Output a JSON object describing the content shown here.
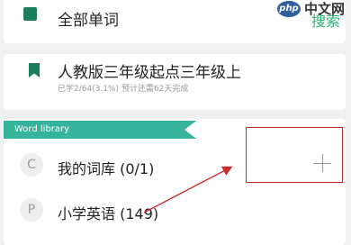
{
  "all_words": {
    "label": "全部单词",
    "search_label": "搜索"
  },
  "current_book": {
    "title": "人教版三年级起点三年级上",
    "progress_text": "已学2/64(3.1%) 预计还需62天完成"
  },
  "word_library": {
    "tab_label": "Word library",
    "items": [
      {
        "initial": "C",
        "label": "我的词库 (0/1)"
      },
      {
        "initial": "P",
        "label": "小学英语 (149)"
      }
    ]
  },
  "add_box": {
    "symbol": "+"
  },
  "watermark": {
    "logo": "php",
    "text": "中文网"
  },
  "colors": {
    "accent_green": "#1a7f5a",
    "teal_tab": "#35b49b",
    "search_green": "#2bb673",
    "annotation_red": "#c92b2b"
  }
}
